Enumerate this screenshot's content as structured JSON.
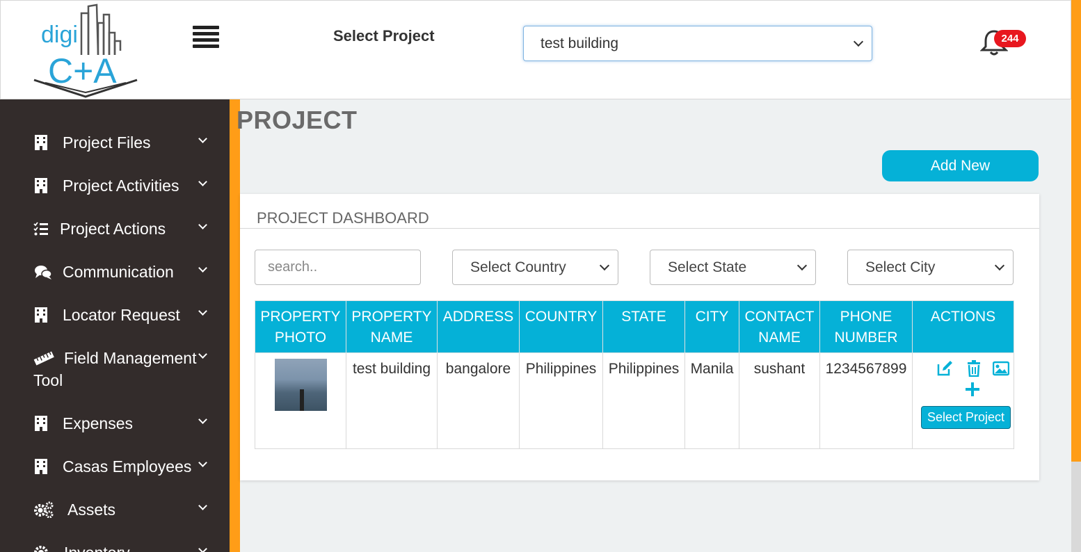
{
  "header": {
    "logo_text_top": "digi",
    "logo_text_bottom": "C+A",
    "select_project_label": "Select Project",
    "selected_project": "test building",
    "notification_count": "244"
  },
  "page": {
    "title": "PROJECT",
    "add_new_label": "Add New"
  },
  "sidebar": {
    "items": [
      {
        "label": "Project Files",
        "icon": "building-icon"
      },
      {
        "label": "Project Activities",
        "icon": "building-icon"
      },
      {
        "label": "Project Actions",
        "icon": "checklist-icon"
      },
      {
        "label": "Communication",
        "icon": "comments-icon"
      },
      {
        "label": "Locator Request",
        "icon": "building-icon"
      },
      {
        "label": "Field Management",
        "label2": "Tool",
        "icon": "ruler-icon"
      },
      {
        "label": "Expenses",
        "icon": "building-icon"
      },
      {
        "label": "Casas Employees",
        "icon": "building-icon"
      },
      {
        "label": "Assets",
        "icon": "gears-icon"
      },
      {
        "label": "Inventory",
        "icon": "gear-icon"
      }
    ]
  },
  "dashboard": {
    "title": "PROJECT DASHBOARD",
    "search_placeholder": "search..",
    "filters": {
      "country": "Select Country",
      "state": "Select State",
      "city": "Select City"
    },
    "columns": [
      [
        "PROPERTY",
        "PHOTO"
      ],
      [
        "PROPERTY",
        "NAME"
      ],
      [
        "ADDRESS",
        ""
      ],
      [
        "COUNTRY",
        ""
      ],
      [
        "STATE",
        ""
      ],
      [
        "CITY",
        ""
      ],
      [
        "CONTACT",
        "NAME"
      ],
      [
        "PHONE",
        "NUMBER"
      ],
      [
        "ACTIONS",
        ""
      ]
    ],
    "rows": [
      {
        "property_name": "test building",
        "address": "bangalore",
        "country": "Philippines",
        "state": "Philippines",
        "city": "Manila",
        "contact_name": "sushant",
        "phone_number": "1234567899",
        "select_label": "Select Project"
      }
    ]
  },
  "colors": {
    "accent": "#05b1d7",
    "sidebar_bg": "#332c2b",
    "orange": "#ff9d17",
    "badge": "#e8171f"
  }
}
